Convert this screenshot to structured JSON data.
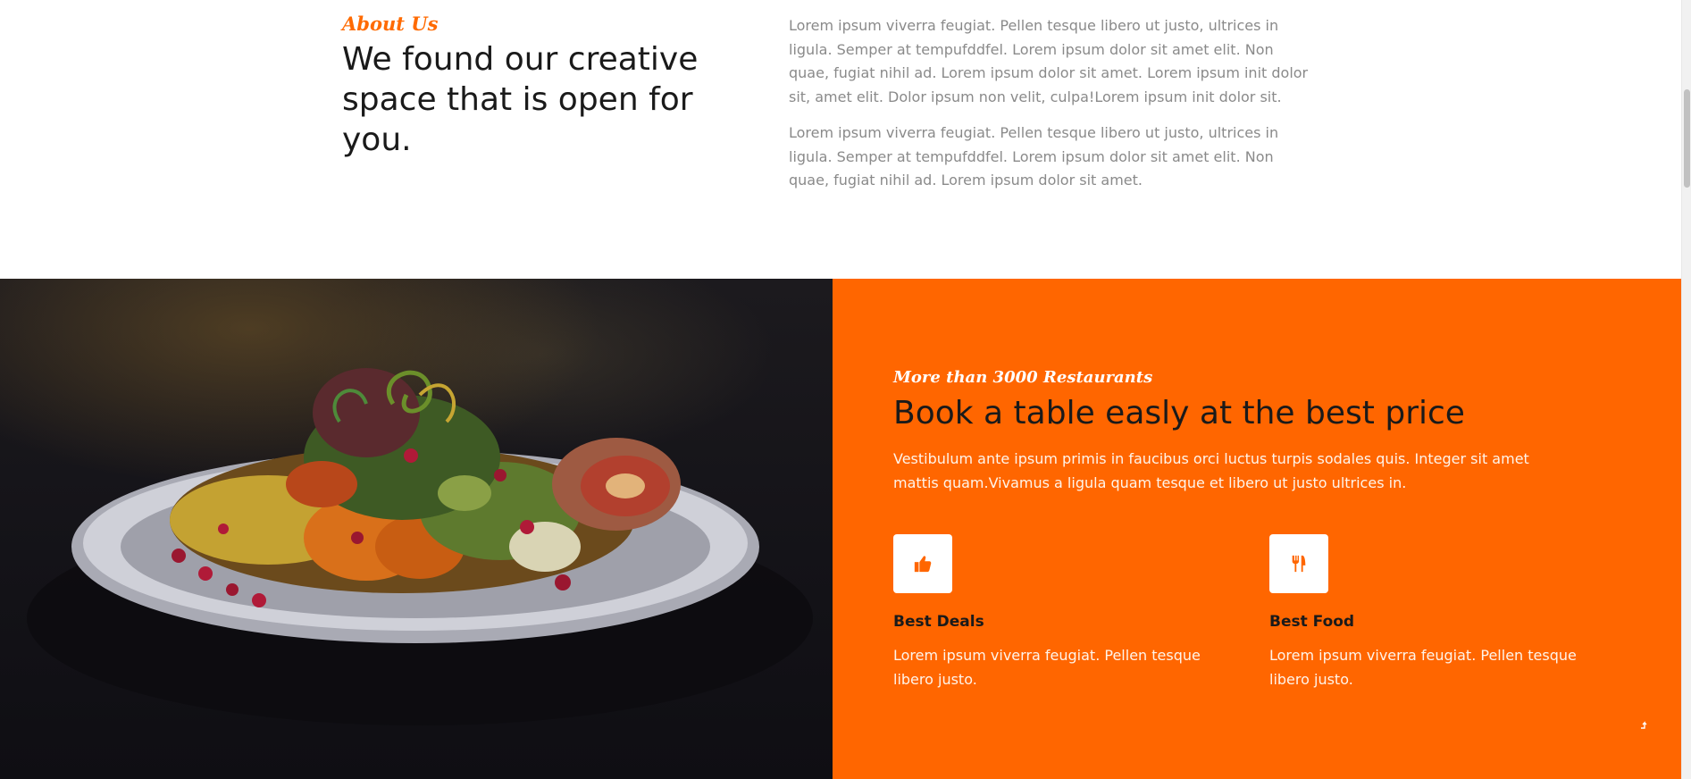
{
  "about": {
    "tag": "About Us",
    "title": "We found our creative space that is open for you.",
    "paragraphs": [
      "Lorem ipsum viverra feugiat. Pellen tesque libero ut justo, ultrices in ligula. Semper at tempufddfel. Lorem ipsum dolor sit amet elit. Non quae, fugiat nihil ad. Lorem ipsum dolor sit amet. Lorem ipsum init dolor sit, amet elit. Dolor ipsum non velit, culpa!Lorem ipsum init dolor sit.",
      "Lorem ipsum viverra feugiat. Pellen tesque libero ut justo, ultrices in ligula. Semper at tempufddfel. Lorem ipsum dolor sit amet elit. Non quae, fugiat nihil ad. Lorem ipsum dolor sit amet."
    ]
  },
  "booking": {
    "tag": "More than 3000 Restaurants",
    "title": "Book a table easly at the best price",
    "description": "Vestibulum ante ipsum primis in faucibus orci luctus turpis sodales quis. Integer sit amet mattis quam.Vivamus a ligula quam tesque et libero ut justo ultrices in.",
    "features": [
      {
        "icon": "thumbs-up-icon",
        "title": "Best Deals",
        "text": "Lorem ipsum viverra feugiat. Pellen tesque libero justo."
      },
      {
        "icon": "fork-knife-icon",
        "title": "Best Food",
        "text": "Lorem ipsum viverra feugiat. Pellen tesque libero justo."
      }
    ],
    "scroll_top_icon": "arrow-up-icon"
  },
  "colors": {
    "accent": "#ff6600",
    "heading": "#1a1a1a",
    "body_text": "#8a8a8a",
    "white": "#ffffff"
  }
}
